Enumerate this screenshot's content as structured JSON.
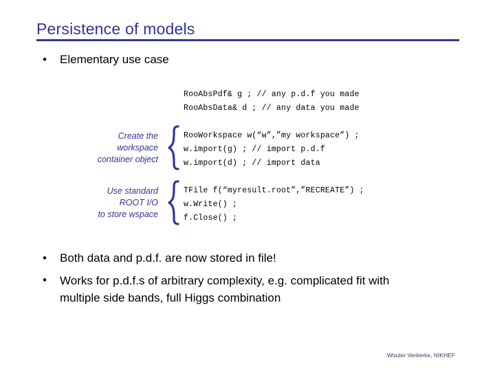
{
  "slide": {
    "title": "Persistence of models",
    "accent_color": "#333399",
    "body_color": "#000000",
    "background_color": "#ffffff",
    "footer": "Wouter Verkerke, NIKHEF"
  },
  "bullets": {
    "top": {
      "marker": "•",
      "text": "Elementary use case"
    },
    "bottom": [
      {
        "marker": "•",
        "text": "Both data and p.d.f. are now stored in file!"
      },
      {
        "marker": "•",
        "text": "Works for p.d.f.s of arbitrary complexity, e.g. complicated fit with multiple side bands, full Higgs combination"
      }
    ]
  },
  "code_blocks": [
    {
      "id": "declarations",
      "lines": [
        "RooAbsPdf& g ; // any p.d.f you made",
        "RooAbsData& d ; // any data you made"
      ],
      "annotation": null
    },
    {
      "id": "workspace",
      "lines": [
        "RooWorkspace w(“w”,”my workspace”) ;",
        "w.import(g) ; // import p.d.f",
        "w.import(d) ; // import data"
      ],
      "annotation": "Create the workspace container object"
    },
    {
      "id": "fileio",
      "lines": [
        "TFile f(“myresult.root”,”RECREATE”) ;",
        "w.Write() ;",
        "f.Close() ;"
      ],
      "annotation": "Use standard ROOT I/O to store wspace"
    }
  ],
  "annotations": [
    {
      "id": "workspace-note",
      "line1": "Create the",
      "line2": "workspace",
      "line3": "container object",
      "text": "Create the workspace container object"
    },
    {
      "id": "fileio-note",
      "line1": "Use standard",
      "line2": "ROOT I/O",
      "line3": "to store wspace",
      "text": "Use standard ROOT I/O to store wspace"
    }
  ],
  "icons": {
    "brace": "curly-brace-icon"
  }
}
